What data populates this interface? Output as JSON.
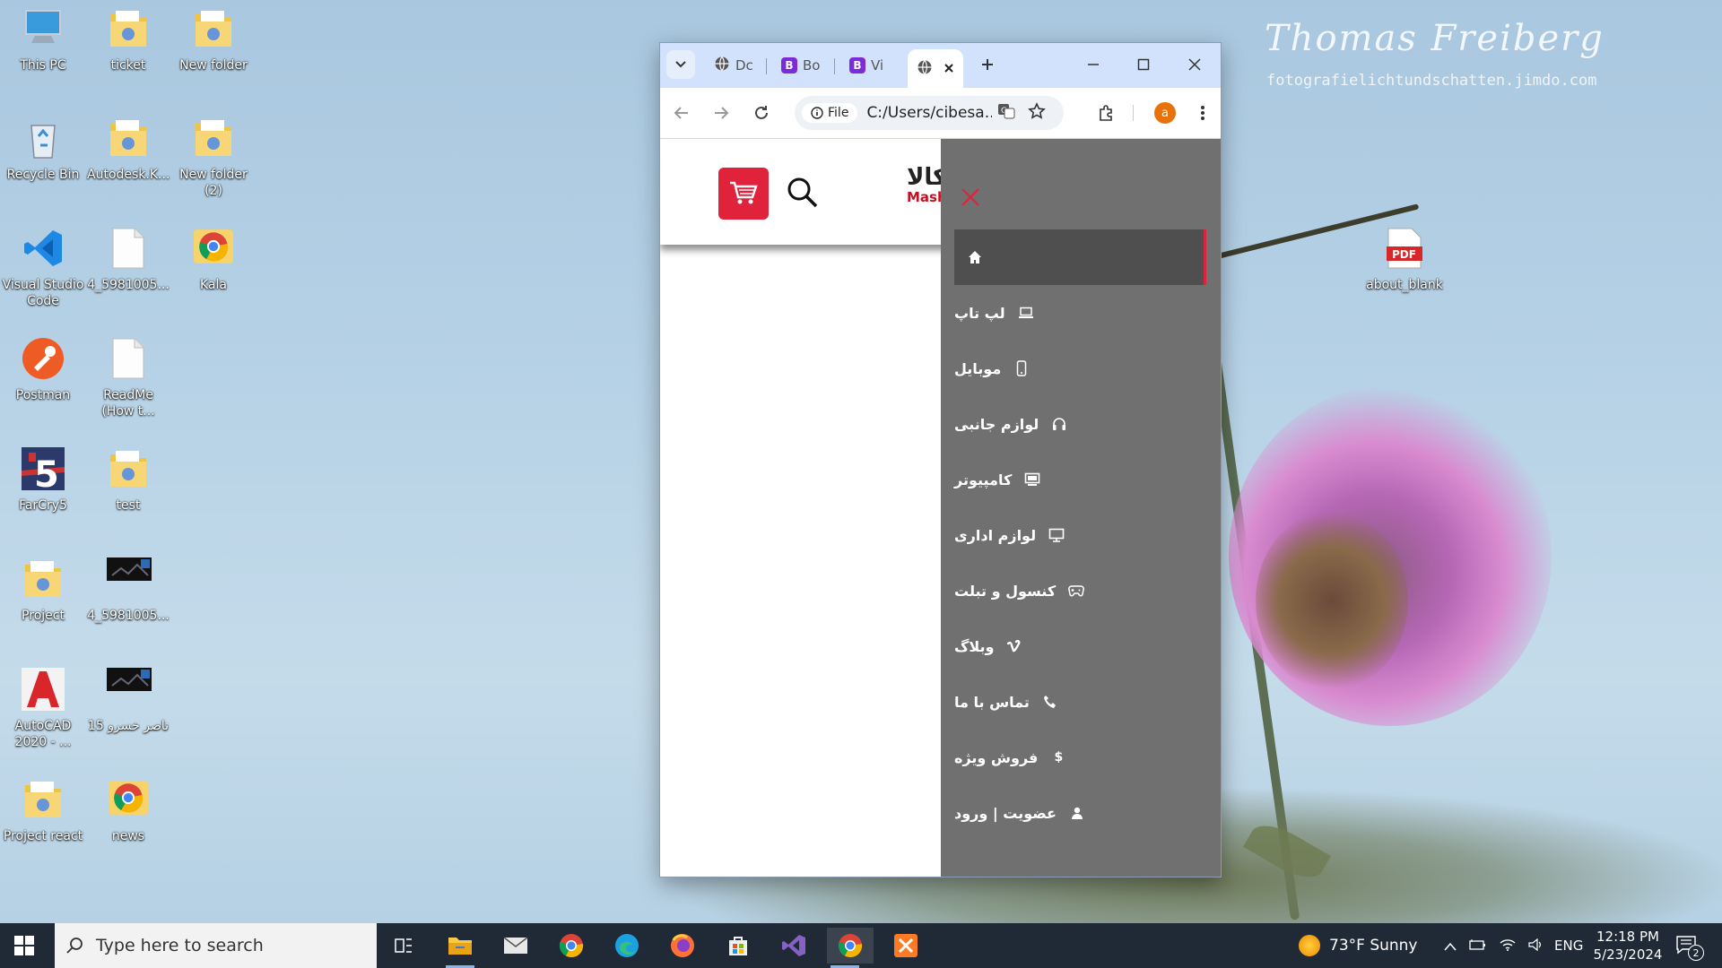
{
  "wallpaper": {
    "watermark": "Thomas Freiberg",
    "watermark_url": "fotografielichtundschatten.jimdo.com"
  },
  "desktop_icons": [
    {
      "label": "This PC",
      "icon": "pc-icon"
    },
    {
      "label": "ticket",
      "icon": "folder-icon"
    },
    {
      "label": "New folder",
      "icon": "folder-icon"
    },
    {
      "label": "Recycle Bin",
      "icon": "recycle-bin-icon"
    },
    {
      "label": "Autodesk.K...",
      "icon": "folder-icon"
    },
    {
      "label": "New folder (2)",
      "icon": "folder-icon"
    },
    {
      "label": "Visual Studio Code",
      "icon": "vscode-icon"
    },
    {
      "label": "4_5981005...",
      "icon": "file-icon"
    },
    {
      "label": "Kala",
      "icon": "chrome-icon"
    },
    {
      "label": "Postman",
      "icon": "postman-icon"
    },
    {
      "label": "ReadMe (How t...",
      "icon": "file-icon"
    },
    {
      "label": "FarCry5",
      "icon": "game-icon"
    },
    {
      "label": "test",
      "icon": "folder-icon"
    },
    {
      "label": "Project",
      "icon": "folder-icon"
    },
    {
      "label": "4_5981005...",
      "icon": "image-icon"
    },
    {
      "label": "AutoCAD 2020 - ...",
      "icon": "autocad-icon"
    },
    {
      "label": "ناصر خسرو 15",
      "icon": "image-icon"
    },
    {
      "label": "Project react",
      "icon": "folder-icon"
    },
    {
      "label": "news",
      "icon": "chrome-icon"
    },
    {
      "label": "about_blank",
      "icon": "pdf-icon"
    }
  ],
  "browser": {
    "tabs": [
      {
        "label": "Dc",
        "icon": "globe-icon"
      },
      {
        "label": "Bo",
        "icon": "bootstrap-icon"
      },
      {
        "label": "Vi",
        "icon": "bootstrap-icon"
      },
      {
        "label": "",
        "icon": "globe-icon",
        "active": true
      }
    ],
    "address_chip": "File",
    "url": "C:/Users/cibesa...",
    "profile_initial": "a"
  },
  "site": {
    "logo_text": "کالا",
    "logo_sub": "Mash",
    "menu": [
      {
        "label": "",
        "icon": "home-icon",
        "active": true
      },
      {
        "label": "لپ تاپ",
        "icon": "laptop-icon"
      },
      {
        "label": "موبایل",
        "icon": "mobile-icon"
      },
      {
        "label": "لوازم جانبی",
        "icon": "headphones-icon"
      },
      {
        "label": "کامپیوتر",
        "icon": "computer-icon"
      },
      {
        "label": "لوازم اداری",
        "icon": "monitor-icon"
      },
      {
        "label": "کنسول و تبلت",
        "icon": "gamepad-icon"
      },
      {
        "label": "وبلاگ",
        "icon": "vimeo-icon"
      },
      {
        "label": "تماس با ما",
        "icon": "phone-icon"
      },
      {
        "label": "فروش ویژه",
        "icon": "dollar-icon"
      },
      {
        "label": "عضویت | ورود",
        "icon": "user-icon"
      }
    ]
  },
  "taskbar": {
    "search_placeholder": "Type here to search",
    "weather": "73°F  Sunny",
    "language": "ENG",
    "time": "12:18 PM",
    "date": "5/23/2024",
    "notifications": "2"
  },
  "colors": {
    "accent_red": "#e0233a",
    "drawer_bg": "#707070",
    "tab_strip": "#d3e2fc"
  }
}
